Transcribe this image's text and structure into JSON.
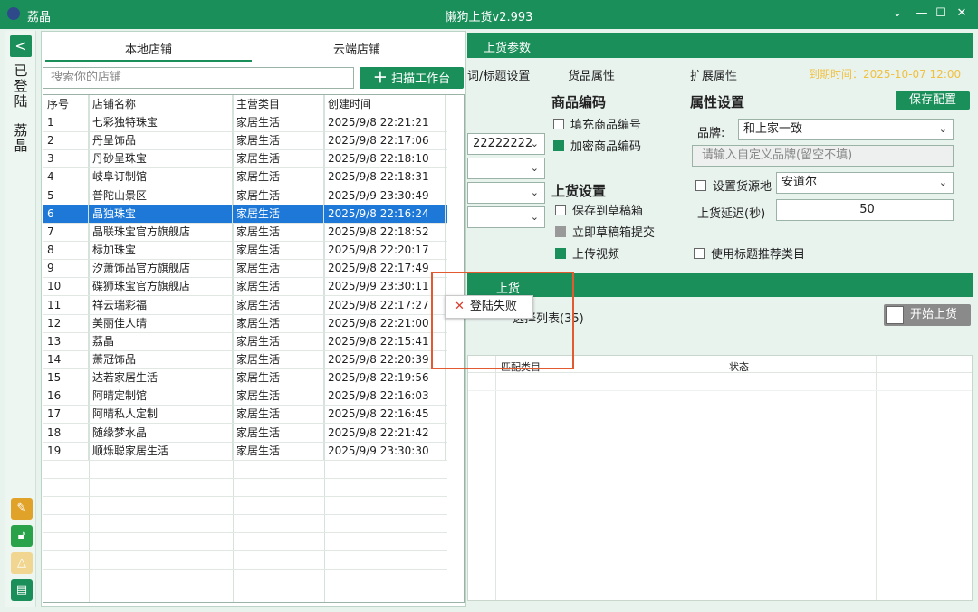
{
  "window": {
    "app_name": "荔晶",
    "title": "懒狗上货v2.993",
    "min": "⌄",
    "min2": "—",
    "max": "☐",
    "close": "✕"
  },
  "sidebar": {
    "back": "<",
    "status": "已登陆",
    "user": "荔晶",
    "icons": [
      "edit-icon",
      "unlock-icon",
      "warning-icon",
      "store-icon"
    ]
  },
  "tabs": [
    "本地店铺",
    "云端店铺"
  ],
  "search": {
    "placeholder": "搜索你的店铺"
  },
  "scan_button": "扫描工作台",
  "store_table": {
    "headers": [
      "序号",
      "店铺名称",
      "主营类目",
      "创建时间"
    ],
    "rows": [
      [
        "1",
        "七彩独特珠宝",
        "家居生活",
        "2025/9/8 22:21:21"
      ],
      [
        "2",
        "丹呈饰品",
        "家居生活",
        "2025/9/8 22:17:06"
      ],
      [
        "3",
        "丹砂呈珠宝",
        "家居生活",
        "2025/9/8 22:18:10"
      ],
      [
        "4",
        "岐阜订制馆",
        "家居生活",
        "2025/9/8 22:18:31"
      ],
      [
        "5",
        "普陀山景区",
        "家居生活",
        "2025/9/9 23:30:49"
      ],
      [
        "6",
        "晶独珠宝",
        "家居生活",
        "2025/9/8 22:16:24"
      ],
      [
        "7",
        "晶联珠宝官方旗舰店",
        "家居生活",
        "2025/9/8 22:18:52"
      ],
      [
        "8",
        "标加珠宝",
        "家居生活",
        "2025/9/8 22:20:17"
      ],
      [
        "9",
        "汐萧饰品官方旗舰店",
        "家居生活",
        "2025/9/8 22:17:49"
      ],
      [
        "10",
        "碟狮珠宝官方旗舰店",
        "家居生活",
        "2025/9/9 23:30:11"
      ],
      [
        "11",
        "祥云瑞彩福",
        "家居生活",
        "2025/9/8 22:17:27"
      ],
      [
        "12",
        "美丽佳人晴",
        "家居生活",
        "2025/9/8 22:21:00"
      ],
      [
        "13",
        "荔晶",
        "家居生活",
        "2025/9/8 22:15:41"
      ],
      [
        "14",
        "萧冠饰品",
        "家居生活",
        "2025/9/8 22:20:39"
      ],
      [
        "15",
        "达若家居生活",
        "家居生活",
        "2025/9/8 22:19:56"
      ],
      [
        "16",
        "阿晴定制馆",
        "家居生活",
        "2025/9/8 22:16:03"
      ],
      [
        "17",
        "阿晴私人定制",
        "家居生活",
        "2025/9/8 22:16:45"
      ],
      [
        "18",
        "随缘梦水晶",
        "家居生活",
        "2025/9/8 22:21:42"
      ],
      [
        "19",
        "顺烁聪家居生活",
        "家居生活",
        "2025/9/9 23:30:30"
      ]
    ],
    "selected_index": 5
  },
  "upload_params": {
    "band_title": "上货参数",
    "tabs": [
      "词/标题设置",
      "货品属性",
      "扩展属性"
    ],
    "date_text": "到期时间：2025-10-07 12:00",
    "save_button": "保存配置",
    "left_value": "22222222",
    "product_code": {
      "title": "商品编码",
      "fill": "填充商品编号",
      "encrypt": "加密商品编码"
    },
    "upload_settings": {
      "title": "上货设置",
      "draft": "保存到草稿箱",
      "submit": "立即草稿箱提交",
      "video": "上传视频"
    },
    "attr_settings": {
      "title": "属性设置",
      "brand_label": "品牌:",
      "brand_value": "和上家一致",
      "custom_brand_placeholder": "请输入自定义品牌(留空不填)",
      "source_label": "设置货源地",
      "source_value": "安道尔",
      "delay_label": "上货延迟(秒)",
      "delay_value": "50",
      "title_rec": "使用标题推荐类目"
    }
  },
  "upload": {
    "band_title": "上货",
    "list_label": "选择列表(35)",
    "start_button": "开始上货",
    "columns": [
      "匹配类目",
      "状态"
    ]
  },
  "popup": {
    "text": "登陆失败"
  }
}
